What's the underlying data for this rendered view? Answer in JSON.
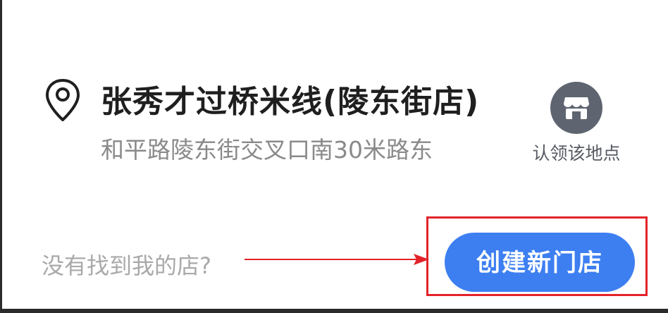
{
  "place": {
    "name": "张秀才过桥米线(陵东街店)",
    "address": "和平路陵东街交叉口南30米路东",
    "pin_icon": "map-pin-icon"
  },
  "claim": {
    "label": "认领该地点",
    "icon": "storefront-icon",
    "icon_bg": "#5e6570"
  },
  "bottom": {
    "prompt": "没有找到我的店?",
    "create_button_label": "创建新门店",
    "button_color": "#3d7ff1",
    "highlight_color": "#e2232a"
  }
}
